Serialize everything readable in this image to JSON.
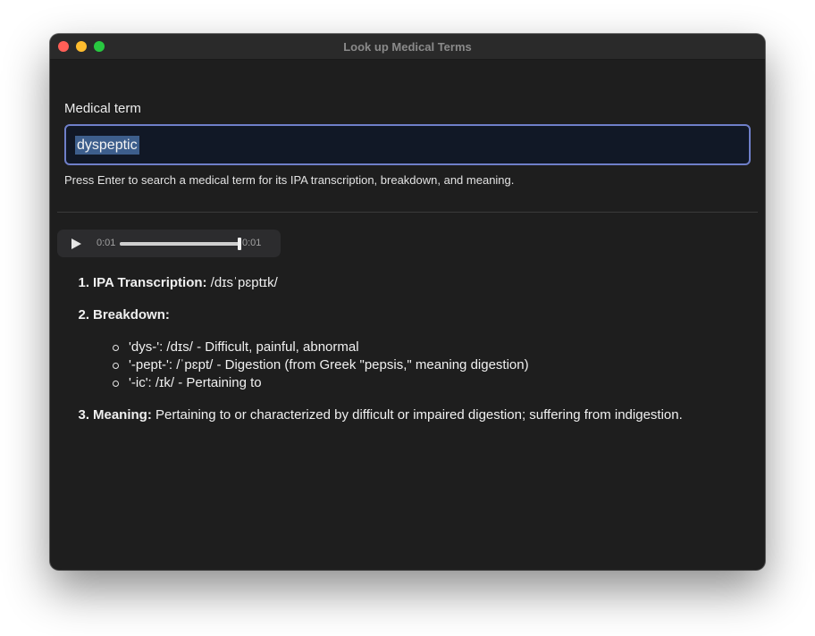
{
  "window": {
    "title": "Look up Medical Terms"
  },
  "form": {
    "label": "Medical term",
    "value": "dyspeptic",
    "help": "Press Enter to search a medical term for its IPA transcription, breakdown, and meaning."
  },
  "audio": {
    "current_time": "0:01",
    "duration": "0:01",
    "progress": 1.0
  },
  "result": {
    "items": [
      {
        "number": "1.",
        "label": "IPA Transcription:",
        "text": " /dɪsˈpɛptɪk/"
      },
      {
        "number": "2.",
        "label": "Breakdown:",
        "text": ""
      },
      {
        "number": "3.",
        "label": "Meaning:",
        "text": " Pertaining to or characterized by difficult or impaired digestion; suffering from indigestion."
      }
    ],
    "breakdown": [
      "'dys-': /dɪs/ - Difficult, painful, abnormal",
      "'-pept-': /ˈpɛpt/ - Digestion (from Greek \"pepsis,\" meaning digestion)",
      "'-ic': /ɪk/ - Pertaining to"
    ]
  }
}
